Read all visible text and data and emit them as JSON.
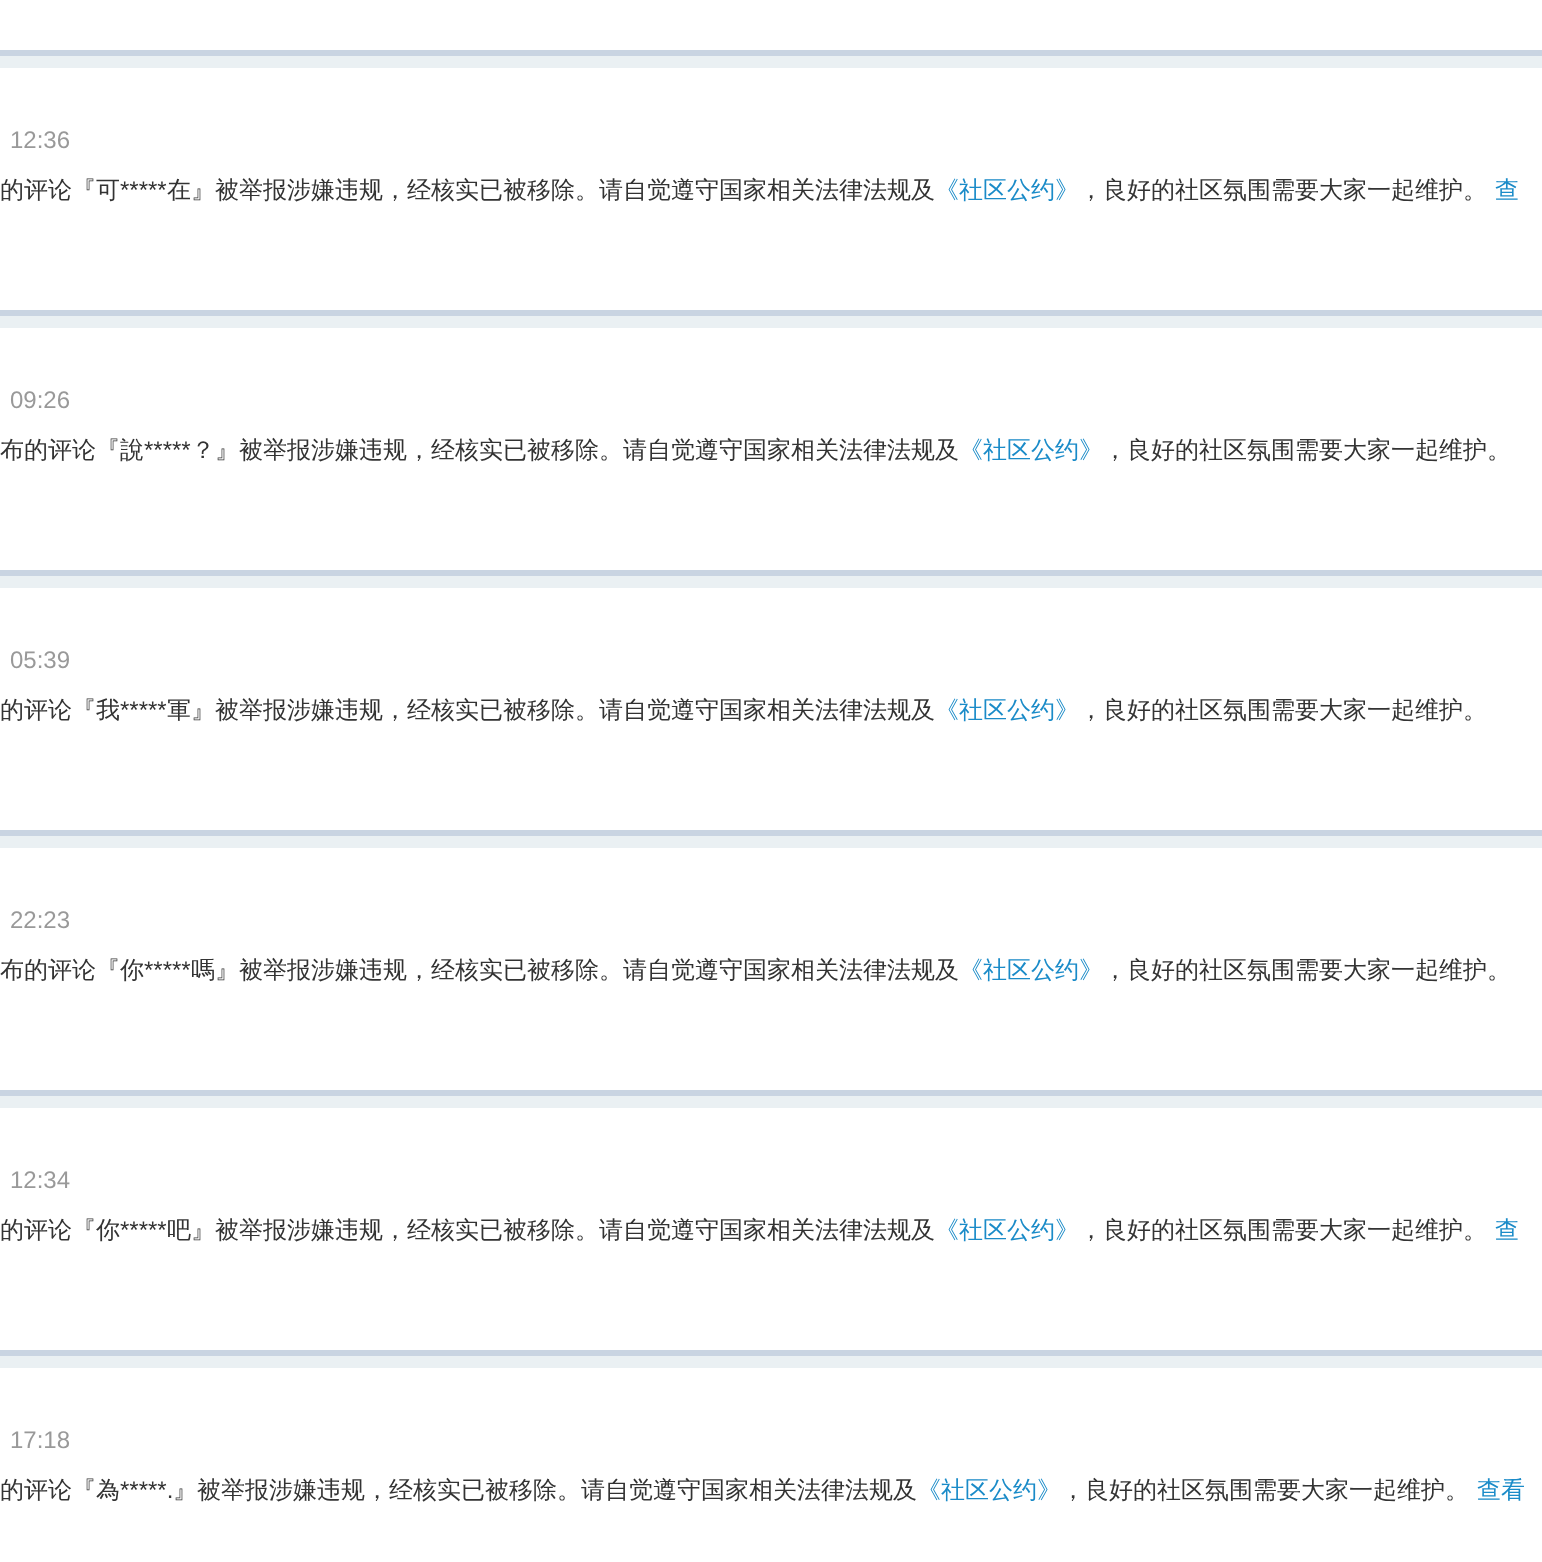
{
  "notices": [
    {
      "time": "12:36",
      "text": "的评论『可*****在』被举报涉嫌违规，经核实已被移除。请自觉遵守国家相关法律法规及",
      "link": "《社区公约》",
      "after": "，良好的社区氛围需要大家一起维护。",
      "more": "查"
    },
    {
      "time": "09:26",
      "text": "布的评论『說*****？』被举报涉嫌违规，经核实已被移除。请自觉遵守国家相关法律法规及",
      "link": "《社区公约》",
      "after": "，良好的社区氛围需要大家一起维护。"
    },
    {
      "time": "05:39",
      "text": "的评论『我*****軍』被举报涉嫌违规，经核实已被移除。请自觉遵守国家相关法律法规及",
      "link": "《社区公约》",
      "after": "，良好的社区氛围需要大家一起维护。"
    },
    {
      "time": "22:23",
      "text": "布的评论『你*****嗎』被举报涉嫌违规，经核实已被移除。请自觉遵守国家相关法律法规及",
      "link": "《社区公约》",
      "after": "，良好的社区氛围需要大家一起维护。"
    },
    {
      "time": "12:34",
      "text": "的评论『你*****吧』被举报涉嫌违规，经核实已被移除。请自觉遵守国家相关法律法规及",
      "link": "《社区公约》",
      "after": "，良好的社区氛围需要大家一起维护。",
      "more": "查"
    },
    {
      "time": "17:18",
      "text": "的评论『為*****.』被举报涉嫌违规，经核实已被移除。请自觉遵守国家相关法律法规及",
      "link": "《社区公约》",
      "after": "，良好的社区氛围需要大家一起维护。",
      "more": "查看"
    }
  ]
}
